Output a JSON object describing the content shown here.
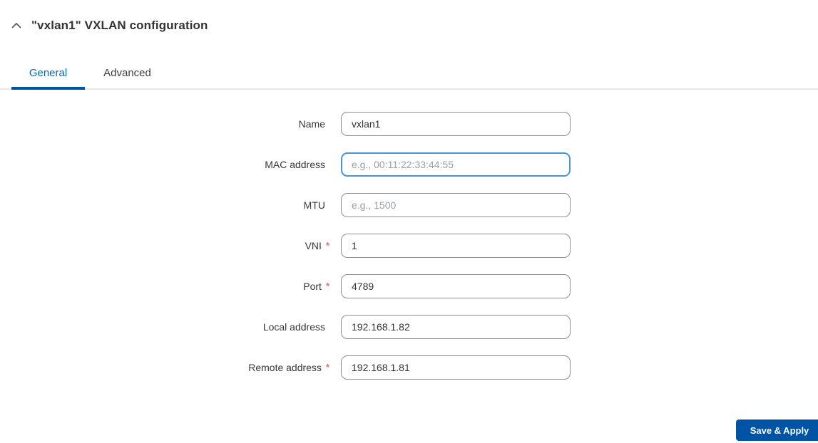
{
  "colors": {
    "accent_blue": "#0054a6",
    "active_tab_text": "#0e64ab",
    "focus_border_blue": "#4596d3",
    "required_red": "#e0716b",
    "input_border_gray": "#8f8f8f",
    "divider_gray": "#e9e9e9",
    "text_dark": "#333333",
    "placeholder_gray": "#9aa1a8"
  },
  "header": {
    "title": "\"vxlan1\" VXLAN configuration",
    "collapse_icon": "chevron-up-icon"
  },
  "tabs": [
    {
      "label": "General",
      "active": true
    },
    {
      "label": "Advanced",
      "active": false
    }
  ],
  "form": {
    "fields": [
      {
        "label": "Name",
        "required_mark": "",
        "value": "vxlan1",
        "placeholder": ""
      },
      {
        "label": "MAC address",
        "required_mark": "",
        "value": "",
        "placeholder": "e.g., 00:11:22:33:44:55",
        "focused": true
      },
      {
        "label": "MTU",
        "required_mark": "",
        "value": "",
        "placeholder": "e.g., 1500"
      },
      {
        "label": "VNI",
        "required_mark": "*",
        "value": "1",
        "placeholder": ""
      },
      {
        "label": "Port",
        "required_mark": "*",
        "value": "4789",
        "placeholder": ""
      },
      {
        "label": "Local address",
        "required_mark": "",
        "value": "192.168.1.82",
        "placeholder": ""
      },
      {
        "label": "Remote address",
        "required_mark": "*",
        "value": "192.168.1.81",
        "placeholder": ""
      }
    ]
  },
  "footer": {
    "save_button_label": "Save & Apply"
  }
}
